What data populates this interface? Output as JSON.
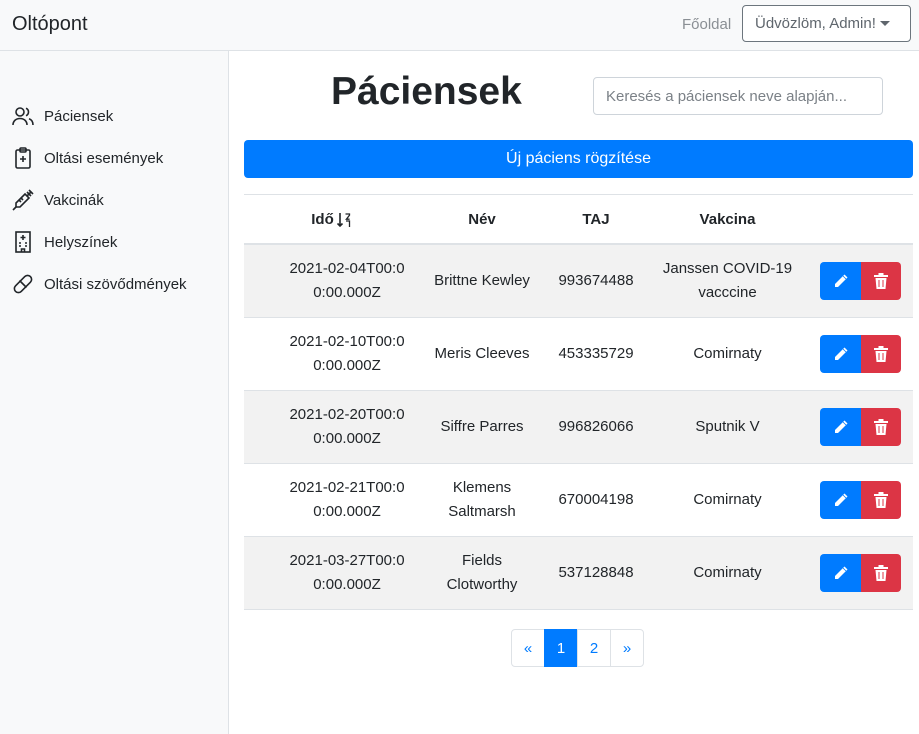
{
  "navbar": {
    "brand": "Oltópont",
    "home_link": "Főoldal",
    "user_menu": "Üdvözlöm, Admin!"
  },
  "sidebar": {
    "items": [
      {
        "label": "Páciensek",
        "icon": "users-icon"
      },
      {
        "label": "Oltási események",
        "icon": "clipboard-plus-icon"
      },
      {
        "label": "Vakcinák",
        "icon": "syringe-icon"
      },
      {
        "label": "Helyszínek",
        "icon": "hospital-icon"
      },
      {
        "label": "Oltási szövődmények",
        "icon": "capsule-icon"
      }
    ]
  },
  "main": {
    "title": "Páciensek",
    "search_placeholder": "Keresés a páciensek neve alapján...",
    "new_button": "Új páciens rögzítése",
    "columns": [
      "Idő",
      "Név",
      "TAJ",
      "Vakcina"
    ],
    "sort_icon": "sort-down-icon",
    "rows": [
      {
        "date": "2021-02-04T00:00:00.000Z",
        "name": "Brittne Kewley",
        "taj": "993674488",
        "vaccine": "Janssen COVID-19 vacccine"
      },
      {
        "date": "2021-02-10T00:00:00.000Z",
        "name": "Meris Cleeves",
        "taj": "453335729",
        "vaccine": "Comirnaty"
      },
      {
        "date": "2021-02-20T00:00:00.000Z",
        "name": "Siffre Parres",
        "taj": "996826066",
        "vaccine": "Sputnik V"
      },
      {
        "date": "2021-02-21T00:00:00.000Z",
        "name": "Klemens Saltmarsh",
        "taj": "670004198",
        "vaccine": "Comirnaty"
      },
      {
        "date": "2021-03-27T00:00:00.000Z",
        "name": "Fields Clotworthy",
        "taj": "537128848",
        "vaccine": "Comirnaty"
      }
    ]
  },
  "pagination": {
    "prev": "«",
    "pages": [
      "1",
      "2"
    ],
    "active": "1",
    "next": "»"
  },
  "colors": {
    "primary": "#007bff",
    "danger": "#dc3545",
    "sidebar_bg": "#f8f9fa",
    "stripe": "#f2f2f2"
  }
}
